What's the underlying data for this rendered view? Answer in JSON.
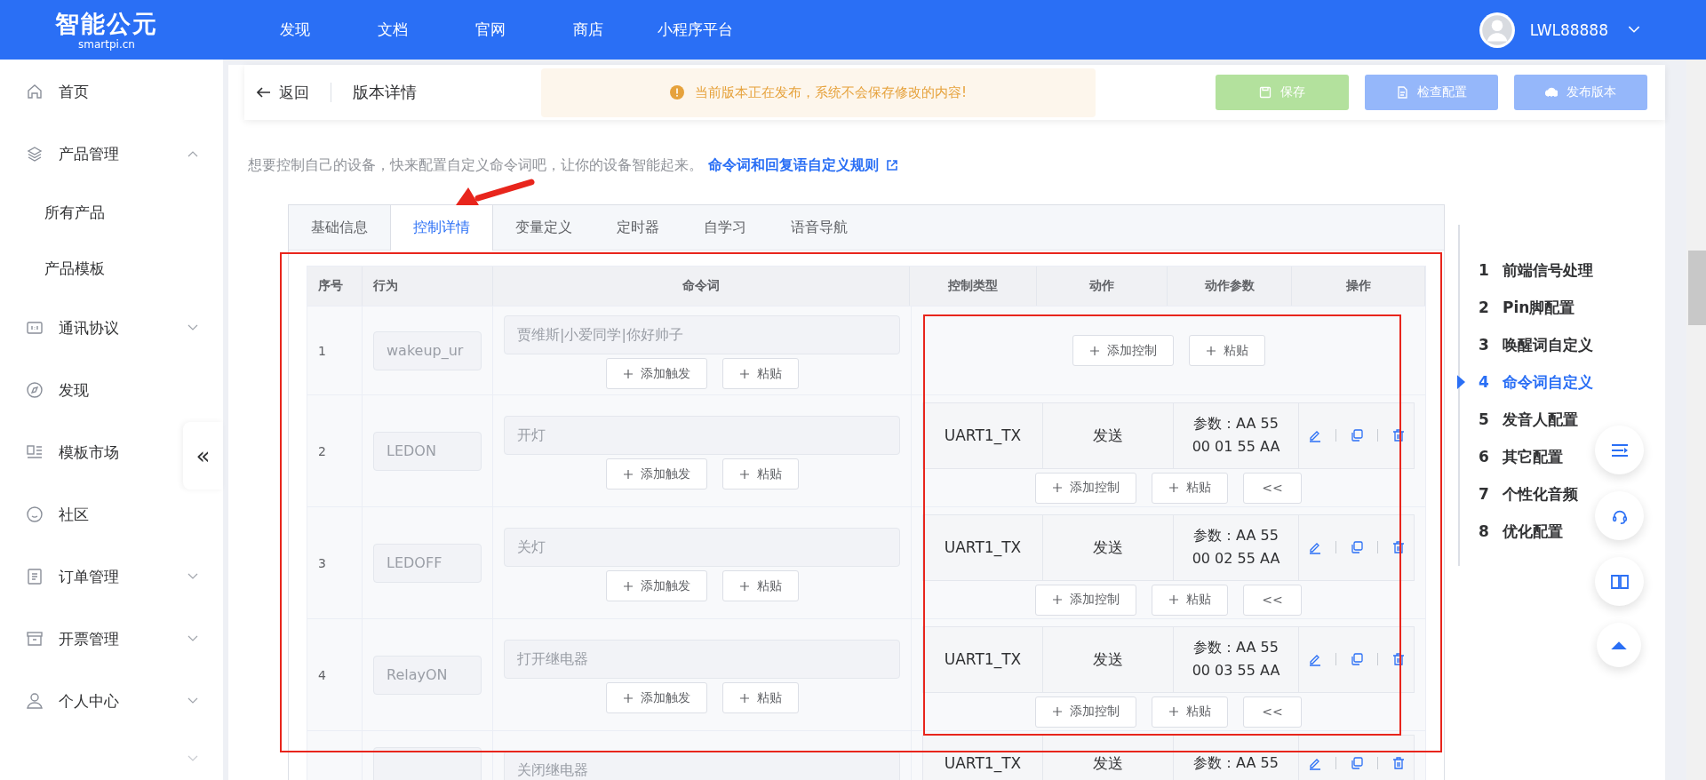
{
  "header": {
    "logo": "智能公元",
    "logo_sub": "smartpi.cn",
    "nav": [
      "发现",
      "文档",
      "官网",
      "商店",
      "小程序平台"
    ],
    "user": "LWL88888"
  },
  "sidebar": {
    "items": [
      {
        "label": "首页"
      },
      {
        "label": "产品管理",
        "expanded": true,
        "children": [
          {
            "label": "所有产品"
          },
          {
            "label": "产品模板"
          }
        ]
      },
      {
        "label": "通讯协议",
        "expanded": false
      },
      {
        "label": "发现"
      },
      {
        "label": "模板市场"
      },
      {
        "label": "社区"
      },
      {
        "label": "订单管理",
        "expanded": false
      },
      {
        "label": "开票管理",
        "expanded": false
      },
      {
        "label": "个人中心",
        "expanded": false
      }
    ],
    "collapse": "«"
  },
  "topbar": {
    "back": "返回",
    "title": "版本详情",
    "alert": "当前版本正在发布，系统不会保存修改的内容!",
    "buttons": [
      {
        "label": "保存",
        "kind": "success",
        "disabled": true
      },
      {
        "label": "检查配置",
        "kind": "primary",
        "disabled": true
      },
      {
        "label": "发布版本",
        "kind": "primary",
        "disabled": true
      }
    ]
  },
  "intro": {
    "text": "想要控制自己的设备，快来配置自定义命令词吧，让你的设备智能起来。",
    "link": "命令词和回复语自定义规则"
  },
  "tabs": [
    {
      "label": "基础信息",
      "selected": false
    },
    {
      "label": "控制详情",
      "selected": true
    },
    {
      "label": "变量定义",
      "selected": false
    },
    {
      "label": "定时器",
      "selected": false
    },
    {
      "label": "自学习",
      "selected": false
    },
    {
      "label": "语音导航",
      "selected": false
    }
  ],
  "table": {
    "columns": [
      "序号",
      "行为",
      "命令词",
      "控制类型",
      "动作",
      "动作参数",
      "操作"
    ],
    "rows": [
      {
        "index": "1",
        "behavior": "wakeup_ur",
        "command": "贾维斯|小爱同学|你好帅子",
        "trigger_buttons": [
          "添加触发",
          "粘贴"
        ],
        "controls": [],
        "control_buttons": [
          "添加控制",
          "粘贴"
        ]
      },
      {
        "index": "2",
        "behavior": "LEDON",
        "command": "开灯",
        "trigger_buttons": [
          "添加触发",
          "粘贴"
        ],
        "controls": [
          {
            "type": "UART1_TX",
            "action": "发送",
            "params": [
              "参数：AA 55",
              "00 01 55 AA"
            ]
          }
        ],
        "control_buttons": [
          "添加控制",
          "粘贴",
          "<<"
        ]
      },
      {
        "index": "3",
        "behavior": "LEDOFF",
        "command": "关灯",
        "trigger_buttons": [
          "添加触发",
          "粘贴"
        ],
        "controls": [
          {
            "type": "UART1_TX",
            "action": "发送",
            "params": [
              "参数：AA 55",
              "00 02 55 AA"
            ]
          }
        ],
        "control_buttons": [
          "添加控制",
          "粘贴",
          "<<"
        ]
      },
      {
        "index": "4",
        "behavior": "RelayON",
        "command": "打开继电器",
        "trigger_buttons": [
          "添加触发",
          "粘贴"
        ],
        "controls": [
          {
            "type": "UART1_TX",
            "action": "发送",
            "params": [
              "参数：AA 55",
              "00 03 55 AA"
            ]
          }
        ],
        "control_buttons": [
          "添加控制",
          "粘贴",
          "<<"
        ]
      },
      {
        "command": "关闭继电器",
        "controls": [
          {
            "type": "UART1_TX",
            "action": "发送",
            "params": [
              "参数：AA 55"
            ]
          }
        ]
      }
    ]
  },
  "steps": [
    {
      "num": "1",
      "label": "前端信号处理",
      "selected": false
    },
    {
      "num": "2",
      "label": "Pin脚配置",
      "selected": false
    },
    {
      "num": "3",
      "label": "唤醒词自定义",
      "selected": false
    },
    {
      "num": "4",
      "label": "命令词自定义",
      "selected": true
    },
    {
      "num": "5",
      "label": "发音人配置",
      "selected": false
    },
    {
      "num": "6",
      "label": "其它配置",
      "selected": false
    },
    {
      "num": "7",
      "label": "个性化音频",
      "selected": false
    },
    {
      "num": "8",
      "label": "优化配置",
      "selected": false
    }
  ]
}
